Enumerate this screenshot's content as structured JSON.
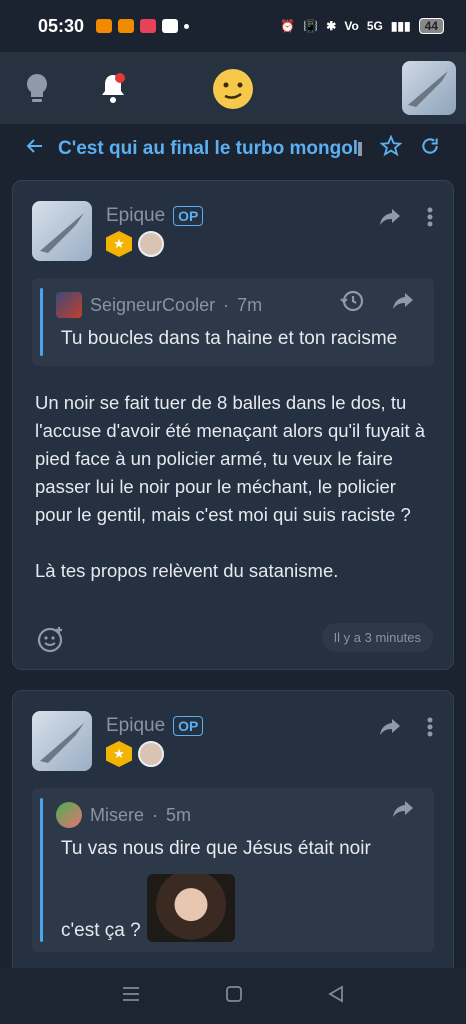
{
  "status_bar": {
    "time": "05:30",
    "battery": "44",
    "network": "5G"
  },
  "app_bar": {
    "icons": [
      "lightbulb-icon",
      "bell-icon",
      "emoji-face-icon",
      "user-avatar"
    ]
  },
  "thread": {
    "title": "C'est qui au final le turbo mongol",
    "icons": [
      "back-arrow-icon",
      "star-icon",
      "refresh-icon"
    ]
  },
  "posts": [
    {
      "author": "Epique",
      "op_label": "OP",
      "quote": {
        "author": "SeigneurCooler",
        "separator": "·",
        "age": "7m",
        "text": "Tu boucles dans ta haine et ton racisme"
      },
      "body": [
        "Un noir se fait tuer de 8 balles dans le dos, tu l'accuse d'avoir été menaçant alors qu'il fuyait à pied face à un policier armé, tu veux le faire passer lui le noir pour le méchant, le policier pour le gentil, mais c'est moi qui suis raciste ?",
        "Là tes propos relèvent du satanisme."
      ],
      "timestamp": "Il y a 3 minutes"
    },
    {
      "author": "Epique",
      "op_label": "OP",
      "quote": {
        "author": "Misere",
        "separator": "·",
        "age": "5m",
        "text": "Tu vas nous dire que Jésus était noir",
        "text2": "c'est ça ?"
      }
    }
  ],
  "colors": {
    "background": "#1b2330",
    "card": "#253041",
    "accent": "#5ab0f0",
    "muted": "#8894a3"
  }
}
